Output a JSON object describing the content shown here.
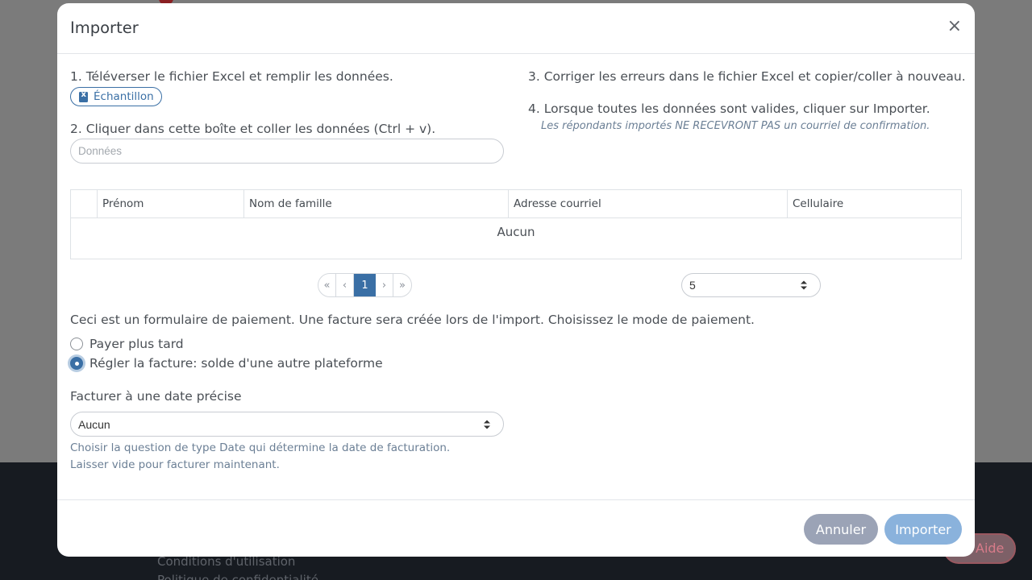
{
  "background": {
    "footer_links": [
      "Conditions d'utilisation",
      "Politique de confidentialité"
    ],
    "help_label": "Aide"
  },
  "modal": {
    "title": "Importer",
    "close_label": "×",
    "steps": {
      "step1": "1. Téléverser le fichier Excel et remplir les données.",
      "sample_label": "Échantillon",
      "step2": "2. Cliquer dans cette boîte et coller les données (Ctrl + v).",
      "data_placeholder": "Données",
      "step3": "3. Corriger les erreurs dans le fichier Excel et copier/coller à nouveau.",
      "step4": "4. Lorsque toutes les données sont valides, cliquer sur Importer.",
      "step4_note": "Les répondants importés NE RECEVRONT PAS un courriel de confirmation."
    },
    "table": {
      "columns": [
        "Prénom",
        "Nom de famille",
        "Adresse courriel",
        "Cellulaire"
      ],
      "empty_label": "Aucun"
    },
    "pagination": {
      "first": "«",
      "prev": "‹",
      "current": "1",
      "next": "›",
      "last": "»",
      "page_size": "5"
    },
    "payment": {
      "intro": "Ceci est un formulaire de paiement. Une facture sera créée lors de l'import. Choisissez le mode de paiement.",
      "option_later": "Payer plus tard",
      "option_settle": "Régler la facture: solde d'une autre plateforme",
      "selected": "option_settle"
    },
    "billing_date": {
      "label": "Facturer à une date précise",
      "value": "Aucun",
      "help": "Choisir la question de type Date qui détermine la date de facturation. Laisser vide pour facturer maintenant."
    },
    "footer": {
      "cancel_label": "Annuler",
      "import_label": "Importer"
    },
    "colors": {
      "accent": "#3a6fa5",
      "primary_disabled": "#8ab2dc",
      "secondary": "#9ba3b6"
    }
  }
}
